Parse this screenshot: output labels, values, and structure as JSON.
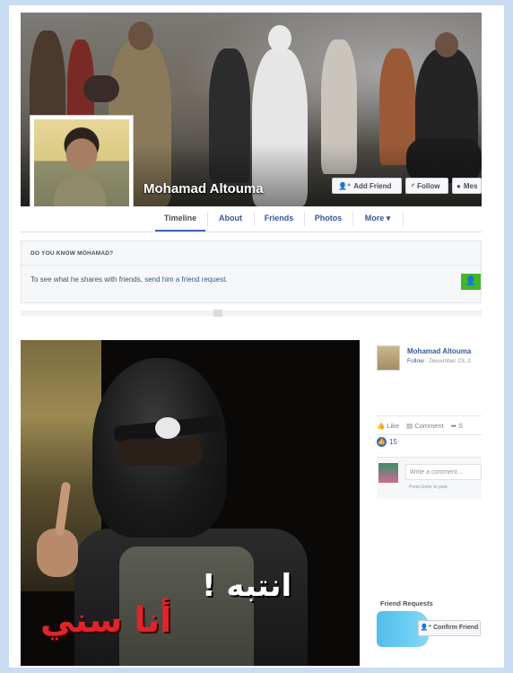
{
  "profile": {
    "name": "Mohamad Altouma",
    "buttons": {
      "add_friend": "Add Friend",
      "follow": "Follow",
      "message": "Mes"
    },
    "tabs": [
      "Timeline",
      "About",
      "Friends",
      "Photos",
      "More ▾"
    ],
    "active_tab": "Timeline"
  },
  "know_box": {
    "heading": "DO YOU KNOW MOHAMAD?",
    "text_prefix": "To see what he shares with friends,",
    "link": "send him a friend request",
    "text_suffix": "."
  },
  "post": {
    "overlay_text_white": "انتبه !",
    "overlay_text_red": "أنا سني",
    "author": "Mohamad Altouma",
    "follow_link": "Follow",
    "date": " · December 23, 2",
    "actions": {
      "like": "Like",
      "comment": "Comment",
      "share": "S"
    },
    "reactions_count": "15",
    "comment_placeholder": "Write a comment...",
    "comment_hint": "Press Enter to post."
  },
  "friend_requests": {
    "title": "Friend Requests",
    "confirm_button": "Confirm Friend"
  },
  "colors": {
    "page_bg": "#c9dcf2",
    "link_blue": "#365899",
    "confirm_green": "#42b72a",
    "red_text": "#e3232b"
  }
}
